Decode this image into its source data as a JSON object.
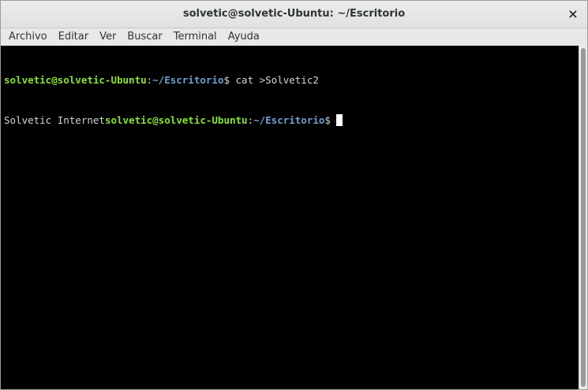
{
  "window": {
    "title": "solvetic@solvetic-Ubuntu: ~/Escritorio",
    "close_glyph": "×"
  },
  "menubar": {
    "items": [
      "Archivo",
      "Editar",
      "Ver",
      "Buscar",
      "Terminal",
      "Ayuda"
    ]
  },
  "terminal": {
    "lines": [
      {
        "prefix": "",
        "user_host": "solvetic@solvetic-Ubuntu",
        "colon": ":",
        "path": "~/Escritorio",
        "dollar": "$",
        "command": " cat >Solvetic2"
      },
      {
        "prefix": "Solvetic Internet",
        "user_host": "solvetic@solvetic-Ubuntu",
        "colon": ":",
        "path": "~/Escritorio",
        "dollar": "$",
        "command": " "
      }
    ],
    "colors": {
      "background": "#000000",
      "user_host": "#8ae234",
      "path": "#729fcf",
      "text": "#d3d7cf"
    }
  }
}
